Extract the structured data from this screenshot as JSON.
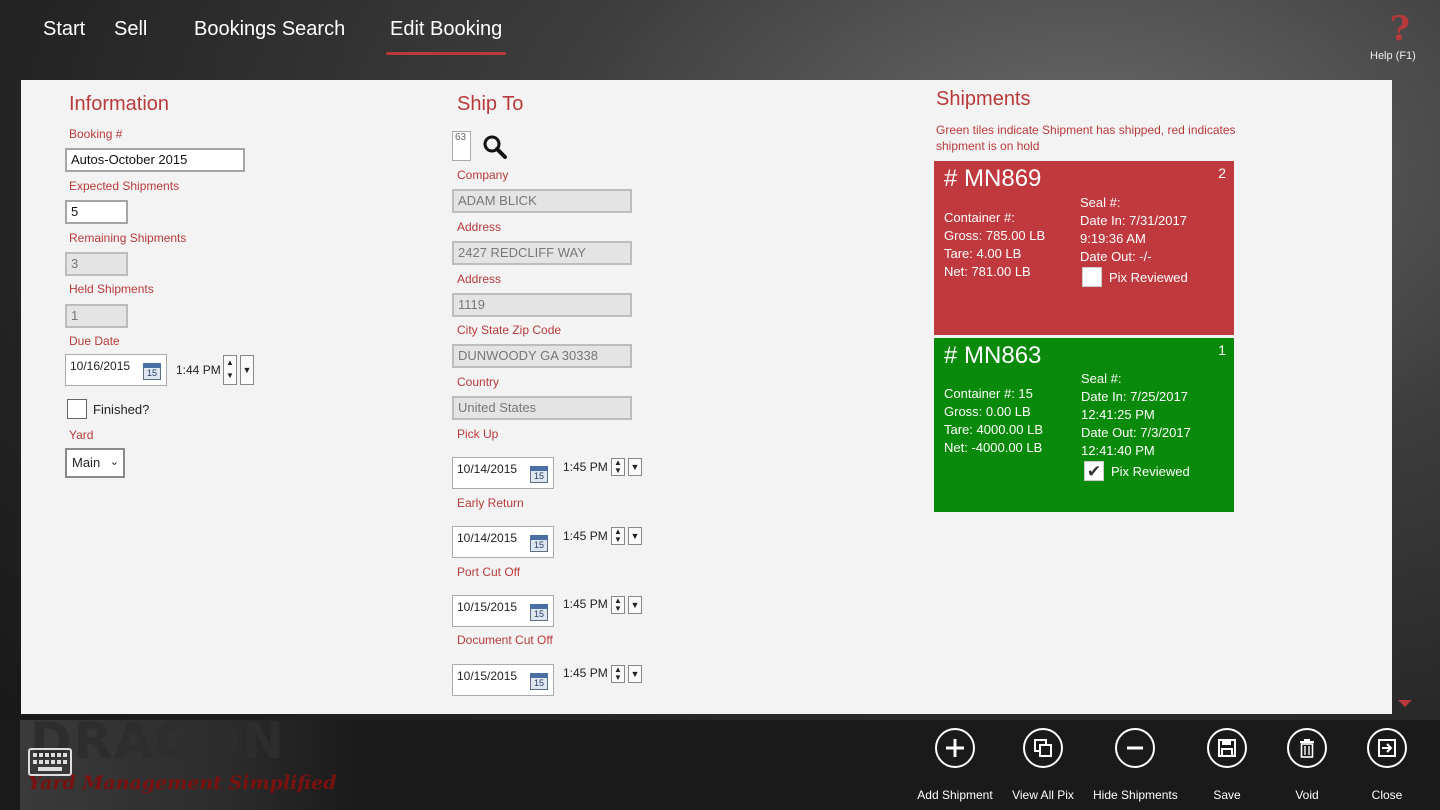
{
  "nav": {
    "items": [
      "Start",
      "Sell",
      "Bookings Search",
      "Edit Booking"
    ],
    "active": "Edit Booking",
    "help_label": "Help (F1)"
  },
  "info": {
    "title": "Information",
    "booking_label": "Booking #",
    "booking_value": "Autos-October 2015",
    "expected_label": "Expected Shipments",
    "expected_value": "5",
    "remaining_label": "Remaining Shipments",
    "remaining_value": "3",
    "held_label": "Held Shipments",
    "held_value": "1",
    "due_label": "Due Date",
    "due_date": "10/16/2015",
    "due_time": "1:44 PM",
    "finished_label": "Finished?",
    "yard_label": "Yard",
    "yard_value": "Main"
  },
  "shipto": {
    "title": "Ship To",
    "id_value": "63",
    "company_label": "Company",
    "company_value": "ADAM BLICK",
    "address1_label": "Address",
    "address1_value": "2427 REDCLIFF WAY",
    "address2_label": "Address",
    "address2_value": "1119",
    "csz_label": "City State Zip Code",
    "csz_value": "DUNWOODY GA 30338",
    "country_label": "Country",
    "country_value": "United States",
    "pickup_label": "Pick Up",
    "pickup_date": "10/14/2015",
    "pickup_time": "1:45 PM",
    "early_label": "Early Return",
    "early_date": "10/14/2015",
    "early_time": "1:45 PM",
    "portcut_label": "Port Cut Off",
    "portcut_date": "10/15/2015",
    "portcut_time": "1:45 PM",
    "doccut_label": "Document Cut Off",
    "doccut_date": "10/15/2015",
    "doccut_time": "1:45 PM",
    "calendar_glyph": "15"
  },
  "shipments": {
    "title": "Shipments",
    "note": "Green tiles indicate Shipment has shipped, red indicates shipment is on hold",
    "tiles": [
      {
        "number": "# MN869",
        "index": "2",
        "status": "hold",
        "color": "#c0393e",
        "container": "Container #:",
        "gross": "Gross: 785.00 LB",
        "tare": "Tare: 4.00 LB",
        "net": "Net: 781.00 LB",
        "seal": "Seal #:",
        "date_in": "Date In: 7/31/2017",
        "date_in_time": "9:19:36 AM",
        "date_out": "Date Out: -/-",
        "date_out_time": "",
        "pix_label": "Pix Reviewed",
        "pix_reviewed": false
      },
      {
        "number": "# MN863",
        "index": "1",
        "status": "shipped",
        "color": "#0a8a0a",
        "container": "Container #: 15",
        "gross": "Gross: 0.00 LB",
        "tare": "Tare: 4000.00 LB",
        "net": "Net: -4000.00 LB",
        "seal": "Seal #:",
        "date_in": "Date In: 7/25/2017",
        "date_in_time": "12:41:25 PM",
        "date_out": "Date Out: 7/3/2017",
        "date_out_time": "12:41:40 PM",
        "pix_label": "Pix Reviewed",
        "pix_reviewed": true
      }
    ]
  },
  "brand": {
    "name": "DRAGON",
    "tagline": "Yard Management Simplified"
  },
  "appbar": {
    "buttons": [
      {
        "label": "Add Shipment",
        "icon": "plus-icon"
      },
      {
        "label": "View All Pix",
        "icon": "copy-icon"
      },
      {
        "label": "Hide Shipments",
        "icon": "minus-icon"
      },
      {
        "label": "Save",
        "icon": "floppy-icon"
      },
      {
        "label": "Void",
        "icon": "trash-icon"
      },
      {
        "label": "Close",
        "icon": "exit-icon"
      }
    ]
  },
  "colors": {
    "accent": "#b83a3a",
    "tile_hold": "#c0393e",
    "tile_shipped": "#0a8a0a"
  }
}
